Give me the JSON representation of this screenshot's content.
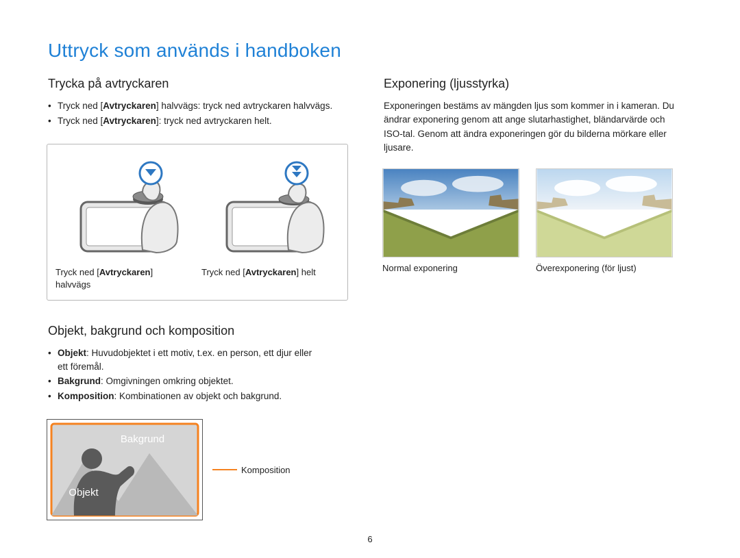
{
  "title": "Uttryck som används i handboken",
  "page_number": "6",
  "left": {
    "section1_heading": "Trycka på avtryckaren",
    "bullets1": {
      "b0_pre": "Tryck ned [",
      "b0_bold": "Avtryckaren",
      "b0_post": "] halvvägs: tryck ned avtryckaren halvvägs.",
      "b1_pre": "Tryck ned [",
      "b1_bold": "Avtryckaren",
      "b1_post": "]: tryck ned avtryckaren helt."
    },
    "shutter_caption_left_pre": "Tryck ned [",
    "shutter_caption_left_bold": "Avtryckaren",
    "shutter_caption_left_post": "]",
    "shutter_caption_left_line2": "halvvägs",
    "shutter_caption_right_pre": "Tryck ned [",
    "shutter_caption_right_bold": "Avtryckaren",
    "shutter_caption_right_post": "] helt",
    "section2_heading": "Objekt, bakgrund och komposition",
    "bullets2": {
      "o_bold": "Objekt",
      "o_post": ": Huvudobjektet i ett motiv, t.ex. en person, ett djur eller",
      "o_line2": "ett föremål.",
      "b_bold": "Bakgrund",
      "b_post": ": Omgivningen omkring objektet.",
      "k_bold": "Komposition",
      "k_post": ": Kombinationen av objekt och bakgrund."
    },
    "comp_bakgrund": "Bakgrund",
    "comp_objekt": "Objekt",
    "comp_callout": "Komposition"
  },
  "right": {
    "section_heading": "Exponering (ljusstyrka)",
    "paragraph": "Exponeringen bestäms av mängden ljus som kommer in i kameran. Du ändrar exponering genom att ange slutarhastighet, bländarvärde och ISO-tal. Genom att ändra exponeringen gör du bilderna mörkare eller ljusare.",
    "photo_left": "Normal exponering",
    "photo_right": "Överexponering (för ljust)"
  }
}
